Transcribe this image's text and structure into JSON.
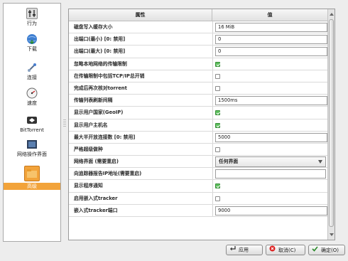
{
  "sidebar": {
    "items": [
      {
        "label": "行为",
        "icon": "behavior-icon"
      },
      {
        "label": "下载",
        "icon": "download-globe-icon"
      },
      {
        "label": "连接",
        "icon": "connection-icon"
      },
      {
        "label": "速度",
        "icon": "speed-gauge-icon"
      },
      {
        "label": "BitTorrent",
        "icon": "bittorrent-icon"
      },
      {
        "label": "网络操作界面",
        "icon": "web-ui-icon"
      },
      {
        "label": "高级",
        "icon": "advanced-folder-icon",
        "selected": true
      }
    ],
    "selected_color": "#f2a33a"
  },
  "table": {
    "headers": [
      "属性",
      "值"
    ],
    "rows": [
      {
        "label": "磁盘写入缓存大小",
        "type": "spin",
        "value": "16 MiB"
      },
      {
        "label": "出端口(最小) [0: 禁用]",
        "type": "spin",
        "value": "0"
      },
      {
        "label": "出端口(最大) [0: 禁用]",
        "type": "spin",
        "value": "0"
      },
      {
        "label": "忽略本地网络的传输限制",
        "type": "check",
        "checked": true
      },
      {
        "label": "在传输限制中包括TCP/IP总开销",
        "type": "check",
        "checked": false
      },
      {
        "label": "完成后再次核对torrent",
        "type": "check",
        "checked": false
      },
      {
        "label": "传输列表刷新间隔",
        "type": "spin",
        "value": "1500ms"
      },
      {
        "label": "显示用户国家(GeoIP)",
        "type": "check",
        "checked": true
      },
      {
        "label": "显示用户主机名",
        "type": "check",
        "checked": true
      },
      {
        "label": "最大半开放连接数 [0: 禁用]",
        "type": "spin",
        "value": "5000"
      },
      {
        "label": "严格超级做种",
        "type": "check",
        "checked": false
      },
      {
        "label": "网络界面 (需要重启)",
        "type": "combo",
        "value": "任何界面"
      },
      {
        "label": "向追踪器报告IP地址(需要重启)",
        "type": "text",
        "value": ""
      },
      {
        "label": "显示程序通知",
        "type": "check",
        "checked": true
      },
      {
        "label": "启用嵌入式tracker",
        "type": "check",
        "checked": false
      },
      {
        "label": "嵌入式tracker端口",
        "type": "spin",
        "value": "9000"
      }
    ]
  },
  "buttons": {
    "apply": "应用",
    "cancel": "取消(C)",
    "ok": "确定(O)"
  }
}
